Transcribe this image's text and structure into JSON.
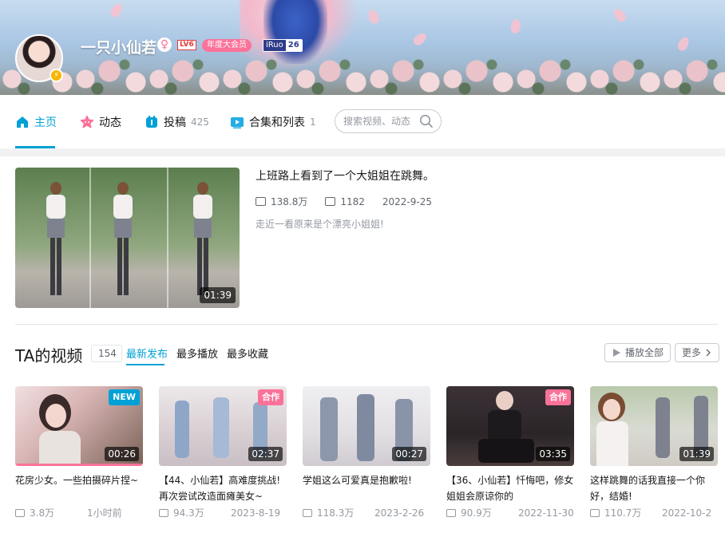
{
  "profile": {
    "username": "一只小仙若",
    "gender_icon": "female-icon",
    "level": "LV6",
    "vip_label": "年度大会员",
    "badge_left": "iRuo",
    "badge_right": "26",
    "avatar_badge": "⚡"
  },
  "nav": {
    "items": [
      {
        "label": "主页",
        "icon": "home-icon",
        "count": ""
      },
      {
        "label": "动态",
        "icon": "dynamic-icon",
        "count": ""
      },
      {
        "label": "投稿",
        "icon": "upload-icon",
        "count": "425"
      },
      {
        "label": "合集和列表",
        "icon": "collection-icon",
        "count": "1"
      }
    ],
    "search_placeholder": "搜索视频、动态"
  },
  "featured": {
    "title": "上班路上看到了一个大姐姐在跳舞。",
    "views": "138.8万",
    "danmaku": "1182",
    "date": "2022-9-25",
    "description": "走近一看原来是个漂亮小姐姐!",
    "duration": "01:39"
  },
  "videos": {
    "title": "TA的视频",
    "count": "154",
    "tabs": [
      "最新发布",
      "最多播放",
      "最多收藏"
    ],
    "play_all": "播放全部",
    "more": "更多",
    "items": [
      {
        "title": "花房少女。一些拍摄碎片捏~",
        "badge": "NEW",
        "duration": "00:26",
        "views": "3.8万",
        "date": "1小时前"
      },
      {
        "title": "【44、小仙若】高难度挑战!再次尝试改造面瘫美女~",
        "badge": "合作",
        "duration": "02:37",
        "views": "94.3万",
        "date": "2023-8-19"
      },
      {
        "title": "学姐这么可爱真是抱歉啦!",
        "badge": "",
        "duration": "00:27",
        "views": "118.3万",
        "date": "2023-2-26"
      },
      {
        "title": "【36、小仙若】忏悔吧，修女姐姐会原谅你的",
        "badge": "合作",
        "duration": "03:35",
        "views": "90.9万",
        "date": "2022-11-30"
      },
      {
        "title": "这样跳舞的话我直接一个你好，结婚!",
        "badge": "",
        "duration": "01:39",
        "views": "110.7万",
        "date": "2022-10-2"
      }
    ]
  },
  "colors": {
    "accent": "#00a1d6",
    "pink": "#fb7299"
  }
}
